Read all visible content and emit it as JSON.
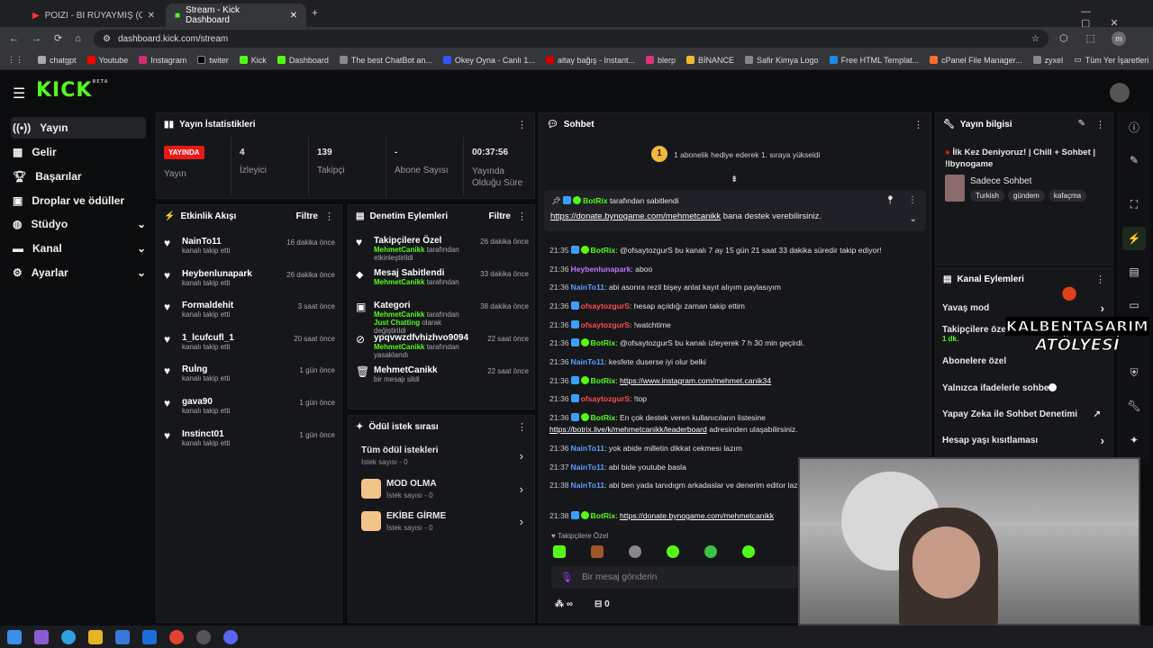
{
  "browser": {
    "tabs": [
      {
        "label": "POIZI - Bİ RÜYAYMIŞ (Offical M"
      },
      {
        "label": "Stream - Kick Dashboard"
      }
    ],
    "url": "dashboard.kick.com/stream",
    "bookmarks": [
      "chatgpt",
      "Youtube",
      "Instagram",
      "twiter",
      "Kick",
      "Dashboard",
      "The best ChatBot an...",
      "Okey Oyna - Canlı 1...",
      "altay bağış - Instant...",
      "blerp",
      "BİNANCE",
      "Safir Kimya Logo",
      "Free HTML Templat...",
      "cPanel File Manager...",
      "zyxel"
    ],
    "all_bookmarks": "Tüm Yer İşaretleri"
  },
  "sidebar": {
    "logo": "KICK",
    "beta": "BETA",
    "items": [
      {
        "label": "Yayın"
      },
      {
        "label": "Gelir"
      },
      {
        "label": "Başarılar"
      },
      {
        "label": "Droplar ve ödüller"
      },
      {
        "label": "Stüdyo"
      },
      {
        "label": "Kanal"
      },
      {
        "label": "Ayarlar"
      }
    ]
  },
  "stats": {
    "title": "Yayın İstatistikleri",
    "live": "YAYINDA",
    "live_sub": "Yayın",
    "viewers": "4",
    "viewers_label": "İzleyici",
    "followers": "139",
    "followers_label": "Takipçi",
    "subs": "-",
    "subs_label": "Abone Sayısı",
    "time": "00:37:56",
    "time_label": "Yayında Olduğu Süre"
  },
  "activity": {
    "title": "Etkinlik Akışı",
    "filter": "Filtre",
    "items": [
      {
        "name": "NainTo11",
        "sub": "kanalı takip etti",
        "time": "16 dakika önce"
      },
      {
        "name": "Heybenlunapark",
        "sub": "kanalı takip etti",
        "time": "26 dakika önce"
      },
      {
        "name": "Formaldehit",
        "sub": "kanalı takip etti",
        "time": "3 saat önce"
      },
      {
        "name": "1_lcufcufl_1",
        "sub": "kanalı takip etti",
        "time": "20 saat önce"
      },
      {
        "name": "Ruİng",
        "sub": "kanalı takip etti",
        "time": "1 gün önce"
      },
      {
        "name": "gava90",
        "sub": "kanalı takip etti",
        "time": "1 gün önce"
      },
      {
        "name": "Instinct01",
        "sub": "kanalı takip etti",
        "time": "1 gün önce"
      }
    ]
  },
  "moderation": {
    "title": "Denetim Eylemleri",
    "filter": "Filtre",
    "items": [
      {
        "title": "Takipçilere Özel",
        "actor": "MehmetCanikk",
        "sub": "tarafından etkinleştirildi",
        "time": "26 dakika önce"
      },
      {
        "title": "Mesaj Sabitlendi",
        "actor": "MehmetCanikk",
        "sub": "tarafından",
        "time": "33 dakika önce"
      },
      {
        "title": "Kategori",
        "actor": "MehmetCanikk",
        "sub": "tarafından",
        "extra": "Just Chatting",
        "sub2": "olarak değiştirildi",
        "time": "38 dakika önce"
      },
      {
        "title": "ypqvwzdfvhizhvo9094",
        "actor": "MehmetCanikk",
        "sub": "tarafından yasaklandı",
        "time": "22 saat önce"
      },
      {
        "title": "MehmetCanikk",
        "actor": "",
        "sub": "bir mesajı sildi",
        "time": "22 saat önce"
      }
    ]
  },
  "rewards": {
    "title": "Ödül istek sırası",
    "items": [
      {
        "title": "Tüm ödül istekleri",
        "sub": "İstek sayısı - 0"
      },
      {
        "title": "MOD OLMA",
        "sub": "İstek sayısı - 0"
      },
      {
        "title": "EKİBE GİRME",
        "sub": "İstek sayısı - 0"
      }
    ]
  },
  "chat": {
    "title": "Sohbet",
    "gift_num": "1",
    "gift_text": "1 abonelik hediye ederek 1. sıraya yükseldi",
    "pinned_by": "BotRix",
    "pinned_text": "tarafından sabitlendi",
    "pinned_link": "https://donate.bynogame.com/mehmetcanikk",
    "pinned_rest": "bana destek verebilirsiniz.",
    "messages": [
      {
        "time": "21:35",
        "user": "BotRix",
        "cls": "u-bot",
        "text": ": @ofsaytozgurS bu kanalı 7 ay 15 gün 21 saat 33 dakika süredir takip ediyor!"
      },
      {
        "time": "21:36",
        "user": "Heybenlunapark",
        "cls": "u-pur",
        "text": ": aboo"
      },
      {
        "time": "21:36",
        "user": "NainTo11",
        "cls": "u-blue",
        "text": ": abi asonra rezil bişey anlat kayıt alıyım paylasıyım"
      },
      {
        "time": "21:36",
        "user": "ofsaytozgurS",
        "cls": "u-red",
        "text": ": hesap açıldığı zaman takip ettim"
      },
      {
        "time": "21:36",
        "user": "ofsaytozgurS",
        "cls": "u-red",
        "text": ": !watchtime"
      },
      {
        "time": "21:36",
        "user": "BotRix",
        "cls": "u-bot",
        "text": ": @ofsaytozgurS bu kanalı izleyerek 7 h 30 min geçirdi."
      },
      {
        "time": "21:36",
        "user": "NainTo11",
        "cls": "u-blue",
        "text": ": kesfete duserse iyi olur belki"
      },
      {
        "time": "21:36",
        "user": "BotRix",
        "cls": "u-bot",
        "text": ": ",
        "link": "https://www.instagram.com/mehmet.canik34"
      },
      {
        "time": "21:36",
        "user": "ofsaytozgurS",
        "cls": "u-red",
        "text": ": !top"
      },
      {
        "time": "21:36",
        "user": "BotRix",
        "cls": "u-bot",
        "text": ": En çok destek veren kullanıcıların listesine ",
        "link": "https://botrix.live/k/mehmetcanikk/leaderboard",
        "after": " adresinden ulaşabilirsiniz."
      },
      {
        "time": "21:36",
        "user": "NainTo11",
        "cls": "u-blue",
        "text": ": yok abide milletin dikkat cekmesı lazım"
      },
      {
        "time": "21:37",
        "user": "NainTo11",
        "cls": "u-blue",
        "text": ": abi bide youtube basla"
      },
      {
        "time": "21:38",
        "user": "NainTo11",
        "cls": "u-blue",
        "text": ": abi ben yada tanıdıgm arkadaslar ve denerim editor lazım"
      },
      {
        "time": "21:38",
        "user": "BotRix",
        "cls": "u-bot",
        "text": ": ",
        "link": "https://donate.bynogame.com/mehmetcanikk"
      }
    ],
    "follow_only": "Takipçilere Özel",
    "placeholder": "Bir mesaj gönderin",
    "points": "∞",
    "gifts": "0"
  },
  "info": {
    "title": "Yayın bilgisi",
    "stream_title": "İlk Kez Deniyoruz! | Chill + Sohbet | !Ibynogame",
    "category": "Sadece Sohbet",
    "tags": [
      "Turkish",
      "gündem",
      "kafaçma"
    ]
  },
  "channel_actions": {
    "title": "Kanal Eylemleri",
    "items": [
      {
        "label": "Yavaş mod"
      },
      {
        "label": "Takipçilere özel",
        "sub": "1 dk."
      },
      {
        "label": "Abonelere özel"
      },
      {
        "label": "Yalnızca ifadelerle sohbet"
      },
      {
        "label": "Yapay Zeka ile Sohbet Denetimi"
      },
      {
        "label": "Hesap yaşı kısıtlaması"
      }
    ]
  },
  "overlay": {
    "line1": "KALBENTASARIM",
    "line2": "ATÖLYESİ"
  },
  "colors": {
    "accent": "#53fc18",
    "live": "#e91916"
  }
}
